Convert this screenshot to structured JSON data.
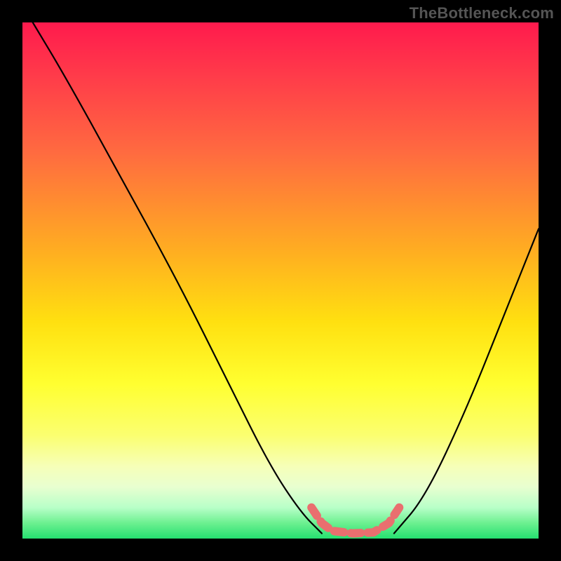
{
  "watermark": "TheBottleneck.com",
  "chart_data": {
    "type": "line",
    "title": "",
    "xlabel": "",
    "ylabel": "",
    "xlim": [
      0,
      100
    ],
    "ylim": [
      0,
      100
    ],
    "grid": false,
    "left_curve": {
      "description": "black V-left branch (bottleneck falloff curve)",
      "points": [
        {
          "x": 2,
          "y": 100
        },
        {
          "x": 8,
          "y": 90
        },
        {
          "x": 18,
          "y": 72
        },
        {
          "x": 30,
          "y": 50
        },
        {
          "x": 40,
          "y": 30
        },
        {
          "x": 48,
          "y": 14
        },
        {
          "x": 54,
          "y": 5
        },
        {
          "x": 58,
          "y": 1
        }
      ]
    },
    "right_curve": {
      "description": "black V-right branch",
      "points": [
        {
          "x": 72,
          "y": 1
        },
        {
          "x": 78,
          "y": 8
        },
        {
          "x": 86,
          "y": 25
        },
        {
          "x": 94,
          "y": 45
        },
        {
          "x": 100,
          "y": 60
        }
      ]
    },
    "highlight_segment": {
      "description": "salmon dotted optimum zone along trough",
      "color": "#e96f6f",
      "points": [
        {
          "x": 56,
          "y": 6
        },
        {
          "x": 58,
          "y": 3
        },
        {
          "x": 60,
          "y": 1.5
        },
        {
          "x": 64,
          "y": 1
        },
        {
          "x": 68,
          "y": 1.2
        },
        {
          "x": 71,
          "y": 3
        },
        {
          "x": 73,
          "y": 6
        }
      ]
    }
  }
}
